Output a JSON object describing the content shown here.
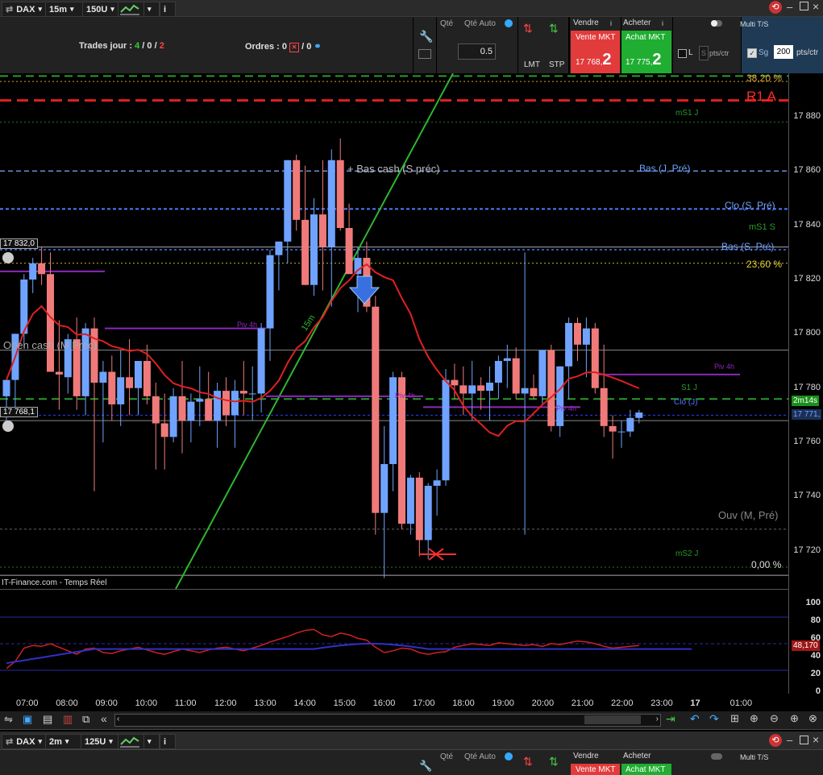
{
  "top_toolbar": {
    "instrument": "DAX",
    "timeframe": "15m",
    "units": "150U",
    "chart_icon": "chart-line-icon"
  },
  "trade_panel": {
    "trades_label": "Trades jour :",
    "trades_a": "4",
    "trades_b": "0",
    "trades_c": "2",
    "orders_label": "Ordres :",
    "orders_a": "0",
    "orders_b": "0",
    "qty_label": "Qté",
    "qty_auto_label": "Qté Auto",
    "qty_value": "0.5",
    "lmt_label": "LMT",
    "stp_label": "STP",
    "sell_label": "Vendre",
    "buy_label": "Acheter",
    "sell_mkt": "Vente MKT",
    "buy_mkt": "Achat MKT",
    "sell_price": "17 768,",
    "sell_price_big": "2",
    "buy_price": "17 775,",
    "buy_price_big": "2",
    "multi_label": "Multi T/S",
    "l_label": "L",
    "s_label": "S",
    "pts_ctr": "pts/ctr",
    "sg_label": "Sg",
    "sg_value": "200",
    "pts_ctr2": "pts/ctr"
  },
  "chart": {
    "source_label": "IT-Finance.com - Temps Réel",
    "price_left_1": "17 832,0",
    "price_left_2": "17 768,1",
    "time_remaining": "2m14s",
    "current_price": "17 771,",
    "rsi_value": "48,170",
    "levels": {
      "fib38": "38,20 %",
      "r1a": "R1 A",
      "ms1j": "mS1 J",
      "bas_cash": "+ Bas cash (S préc)",
      "bas_j": "Bas (J, Pré)",
      "clo_s": "Clo (S, Pré)",
      "ms1s": "mS1 S",
      "bas_s": "Bas (S, Pré)",
      "fib23": "23,60 %",
      "open_cash": "Open cash (M Préc)",
      "piv4h_a": "Piv 4h",
      "piv4h_b": "Piv 4h",
      "piv4h_c": "Piv 4h",
      "piv4h_d": "Piv 4h",
      "s1j": "S1 J",
      "cloj": "Clo (J)",
      "ouv": "Ouv (M, Pré)",
      "ms2j": "mS2 J",
      "fib0": "0,00 %",
      "trend_label": "15m"
    },
    "y_ticks": [
      "17 880",
      "17 860",
      "17 840",
      "17 820",
      "17 800",
      "17 780",
      "17 760",
      "17 740",
      "17 720"
    ],
    "rsi_ticks": [
      "100",
      "80",
      "60",
      "40",
      "20",
      "0"
    ],
    "x_ticks": [
      "07:00",
      "08:00",
      "09:00",
      "10:00",
      "11:00",
      "12:00",
      "13:00",
      "14:00",
      "15:00",
      "16:00",
      "17:00",
      "18:00",
      "19:00",
      "20:00",
      "21:00",
      "22:00",
      "23:00",
      "17",
      "01:00"
    ]
  },
  "chart_data": {
    "type": "candlestick",
    "title": "",
    "symbol": "DAX",
    "interval": "15m",
    "ylim": [
      17706,
      17896
    ],
    "candles": [
      {
        "o": 17777,
        "h": 17783,
        "l": 17768,
        "c": 17783
      },
      {
        "o": 17783,
        "h": 17800,
        "l": 17773,
        "c": 17800
      },
      {
        "o": 17800,
        "h": 17822,
        "l": 17795,
        "c": 17820
      },
      {
        "o": 17820,
        "h": 17828,
        "l": 17815,
        "c": 17826
      },
      {
        "o": 17826,
        "h": 17832,
        "l": 17818,
        "c": 17822
      },
      {
        "o": 17822,
        "h": 17830,
        "l": 17790,
        "c": 17786
      },
      {
        "o": 17786,
        "h": 17805,
        "l": 17772,
        "c": 17785
      },
      {
        "o": 17784,
        "h": 17800,
        "l": 17778,
        "c": 17798
      },
      {
        "o": 17798,
        "h": 17806,
        "l": 17772,
        "c": 17777
      },
      {
        "o": 17777,
        "h": 17804,
        "l": 17770,
        "c": 17802
      },
      {
        "o": 17802,
        "h": 17806,
        "l": 17742,
        "c": 17782
      },
      {
        "o": 17782,
        "h": 17790,
        "l": 17760,
        "c": 17786
      },
      {
        "o": 17786,
        "h": 17792,
        "l": 17768,
        "c": 17774
      },
      {
        "o": 17774,
        "h": 17794,
        "l": 17766,
        "c": 17784
      },
      {
        "o": 17784,
        "h": 17798,
        "l": 17770,
        "c": 17780
      },
      {
        "o": 17780,
        "h": 17790,
        "l": 17770,
        "c": 17790
      },
      {
        "o": 17790,
        "h": 17796,
        "l": 17774,
        "c": 17777
      },
      {
        "o": 17777,
        "h": 17782,
        "l": 17750,
        "c": 17767
      },
      {
        "o": 17767,
        "h": 17778,
        "l": 17750,
        "c": 17762
      },
      {
        "o": 17762,
        "h": 17780,
        "l": 17760,
        "c": 17777
      },
      {
        "o": 17777,
        "h": 17790,
        "l": 17756,
        "c": 17768
      },
      {
        "o": 17768,
        "h": 17778,
        "l": 17760,
        "c": 17775
      },
      {
        "o": 17775,
        "h": 17788,
        "l": 17766,
        "c": 17776
      },
      {
        "o": 17776,
        "h": 17786,
        "l": 17770,
        "c": 17768
      },
      {
        "o": 17768,
        "h": 17782,
        "l": 17758,
        "c": 17779
      },
      {
        "o": 17779,
        "h": 17784,
        "l": 17766,
        "c": 17770
      },
      {
        "o": 17770,
        "h": 17783,
        "l": 17758,
        "c": 17779
      },
      {
        "o": 17779,
        "h": 17790,
        "l": 17770,
        "c": 17778
      },
      {
        "o": 17778,
        "h": 17788,
        "l": 17768,
        "c": 17778
      },
      {
        "o": 17778,
        "h": 17804,
        "l": 17771,
        "c": 17802
      },
      {
        "o": 17802,
        "h": 17831,
        "l": 17790,
        "c": 17829
      },
      {
        "o": 17829,
        "h": 17834,
        "l": 17816,
        "c": 17834
      },
      {
        "o": 17834,
        "h": 17864,
        "l": 17826,
        "c": 17864
      },
      {
        "o": 17864,
        "h": 17866,
        "l": 17838,
        "c": 17842
      },
      {
        "o": 17842,
        "h": 17862,
        "l": 17818,
        "c": 17818
      },
      {
        "o": 17818,
        "h": 17850,
        "l": 17814,
        "c": 17844
      },
      {
        "o": 17844,
        "h": 17864,
        "l": 17816,
        "c": 17832
      },
      {
        "o": 17832,
        "h": 17868,
        "l": 17810,
        "c": 17864
      },
      {
        "o": 17864,
        "h": 17872,
        "l": 17838,
        "c": 17839
      },
      {
        "o": 17839,
        "h": 17848,
        "l": 17830,
        "c": 17822
      },
      {
        "o": 17822,
        "h": 17832,
        "l": 17808,
        "c": 17828
      },
      {
        "o": 17828,
        "h": 17834,
        "l": 17808,
        "c": 17810
      },
      {
        "o": 17810,
        "h": 17814,
        "l": 17726,
        "c": 17734
      },
      {
        "o": 17734,
        "h": 17766,
        "l": 17710,
        "c": 17752
      },
      {
        "o": 17752,
        "h": 17786,
        "l": 17742,
        "c": 17784
      },
      {
        "o": 17784,
        "h": 17786,
        "l": 17728,
        "c": 17730
      },
      {
        "o": 17730,
        "h": 17748,
        "l": 17726,
        "c": 17747
      },
      {
        "o": 17747,
        "h": 17749,
        "l": 17718,
        "c": 17724
      },
      {
        "o": 17724,
        "h": 17745,
        "l": 17717,
        "c": 17744
      },
      {
        "o": 17744,
        "h": 17750,
        "l": 17733,
        "c": 17746
      },
      {
        "o": 17746,
        "h": 17787,
        "l": 17744,
        "c": 17783
      },
      {
        "o": 17783,
        "h": 17789,
        "l": 17776,
        "c": 17781
      },
      {
        "o": 17781,
        "h": 17788,
        "l": 17770,
        "c": 17778
      },
      {
        "o": 17778,
        "h": 17790,
        "l": 17768,
        "c": 17781
      },
      {
        "o": 17781,
        "h": 17784,
        "l": 17772,
        "c": 17779
      },
      {
        "o": 17779,
        "h": 17788,
        "l": 17768,
        "c": 17782
      },
      {
        "o": 17782,
        "h": 17792,
        "l": 17776,
        "c": 17790
      },
      {
        "o": 17790,
        "h": 17796,
        "l": 17780,
        "c": 17791
      },
      {
        "o": 17791,
        "h": 17795,
        "l": 17776,
        "c": 17778
      },
      {
        "o": 17778,
        "h": 17830,
        "l": 17726,
        "c": 17780
      },
      {
        "o": 17780,
        "h": 17785,
        "l": 17776,
        "c": 17777
      },
      {
        "o": 17777,
        "h": 17794,
        "l": 17774,
        "c": 17794
      },
      {
        "o": 17794,
        "h": 17796,
        "l": 17764,
        "c": 17766
      },
      {
        "o": 17766,
        "h": 17788,
        "l": 17762,
        "c": 17788
      },
      {
        "o": 17788,
        "h": 17806,
        "l": 17776,
        "c": 17804
      },
      {
        "o": 17804,
        "h": 17806,
        "l": 17790,
        "c": 17796
      },
      {
        "o": 17796,
        "h": 17806,
        "l": 17784,
        "c": 17802
      },
      {
        "o": 17802,
        "h": 17804,
        "l": 17778,
        "c": 17780
      },
      {
        "o": 17780,
        "h": 17796,
        "l": 17762,
        "c": 17766
      },
      {
        "o": 17766,
        "h": 17770,
        "l": 17754,
        "c": 17764
      },
      {
        "o": 17764,
        "h": 17768,
        "l": 17758,
        "c": 17764
      },
      {
        "o": 17764,
        "h": 17772,
        "l": 17762,
        "c": 17769
      },
      {
        "o": 17769,
        "h": 17772,
        "l": 17767,
        "c": 17771
      }
    ]
  },
  "bottom_toolbar": {
    "instrument": "DAX",
    "timeframe": "2m",
    "units": "125U",
    "qty_label": "Qté",
    "qty_auto_label": "Qté Auto",
    "sell_label": "Vendre",
    "buy_label": "Acheter",
    "sell_mkt": "Vente MKT",
    "buy_mkt": "Achat MKT",
    "multi_label": "Multi T/S"
  }
}
